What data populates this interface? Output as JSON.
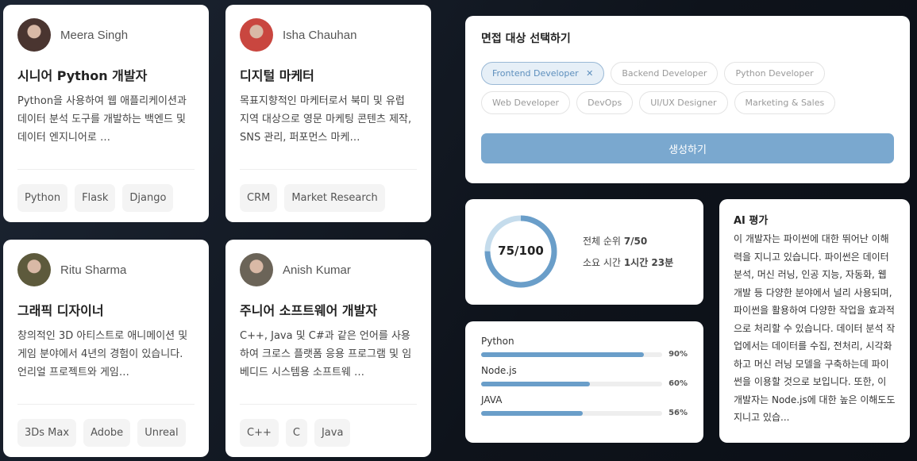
{
  "profiles": [
    {
      "name": "Meera Singh",
      "title": "시니어 Python 개발자",
      "desc": "Python을 사용하여 웹 애플리케이션과 데이터 분석 도구를 개발하는 백엔드 및 데이터 엔지니어로 …",
      "tags": [
        "Python",
        "Flask",
        "Django"
      ],
      "avatar_color": "#4a3530"
    },
    {
      "name": "Isha Chauhan",
      "title": "디지털 마케터",
      "desc": "목표지향적인 마케터로서 북미 및 유럽 지역 대상으로 영문 마케팅 콘텐츠 제작, SNS 관리, 퍼포먼스 마케…",
      "tags": [
        "CRM",
        "Market Research"
      ],
      "avatar_color": "#c9463f"
    },
    {
      "name": "Ritu Sharma",
      "title": "그래픽 디자이너",
      "desc": "창의적인 3D 아티스트로 애니메이션 및 게임 분야에서 4년의 경험이 있습니다. 언리얼 프로젝트와 게임…",
      "tags": [
        "3Ds Max",
        "Adobe",
        "Unreal"
      ],
      "avatar_color": "#5d5a3c"
    },
    {
      "name": "Anish Kumar",
      "title": "주니어 소프트웨어 개발자",
      "desc": "C++, Java 및 C#과 같은 언어를 사용하여 크로스 플랫폼 응용 프로그램 및 임베디드 시스템용 소프트웨 …",
      "tags": [
        "C++",
        "C",
        "Java"
      ],
      "avatar_color": "#6b6458"
    }
  ],
  "selector": {
    "title": "면접 대상 선택하기",
    "chips": [
      "Frontend Developer",
      "Backend Developer",
      "Python Developer",
      "Web Developer",
      "DevOps",
      "UI/UX Designer",
      "Marketing & Sales"
    ],
    "selected": "Frontend Developer",
    "generate_label": "생성하기"
  },
  "score": {
    "value": "75/100",
    "fraction": 0.75,
    "rank_label": "전체 순위",
    "rank": "7/50",
    "time_label": "소요 시간",
    "time": "1시간 23분"
  },
  "skills": [
    {
      "name": "Python",
      "pct": 90,
      "label": "90%"
    },
    {
      "name": "Node.js",
      "pct": 60,
      "label": "60%"
    },
    {
      "name": "JAVA",
      "pct": 56,
      "label": "56%"
    }
  ],
  "ai": {
    "title": "AI 평가",
    "text": "이 개발자는 파이썬에 대한 뛰어난 이해력을 지니고 있습니다. 파이썬은 데이터 분석, 머신 러닝, 인공 지능, 자동화, 웹 개발 등 다양한 분야에서 널리 사용되며, 파이썬을 활용하여 다양한 작업을 효과적으로 처리할 수 있습니다. 데이터 분석 작업에서는 데이터를 수집, 전처리, 시각화하고 머신 러닝 모델을 구축하는데 파이썬을 이용할 것으로 보입니다. 또한, 이 개발자는 Node.js에 대한 높은 이해도도 지니고 있습..."
  },
  "colors": {
    "accent": "#6a9ec9",
    "ring_light": "#c5dcec"
  }
}
